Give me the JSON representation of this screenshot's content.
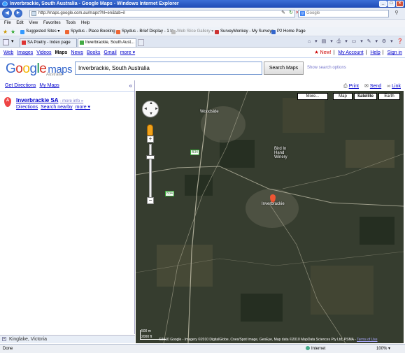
{
  "window": {
    "title": "Inverbrackie, South Australia - Google Maps - Windows Internet Explorer"
  },
  "address": {
    "url": "http://maps.google.com.au/maps?hl=en&tab=il",
    "search_placeholder": "Google"
  },
  "menu": [
    "File",
    "Edit",
    "View",
    "Favorites",
    "Tools",
    "Help"
  ],
  "favorites": [
    "Suggested Sites ▾",
    "Spydus - Place Booking",
    "Spydus - Brief Display - 1 to...",
    "Web Slice Gallery ▾",
    "SurveyMonkey - My Surveys",
    "P2 Home Page"
  ],
  "tabs": [
    {
      "label": "SA Poetry - Index page",
      "active": false
    },
    {
      "label": "Inverbrackie, South Aust...",
      "active": true
    }
  ],
  "google_bar": {
    "links": [
      "Web",
      "Images",
      "Videos"
    ],
    "current": "Maps",
    "links2": [
      "News",
      "Books",
      "Gmail",
      "more ▾"
    ],
    "right": {
      "new": "★ New!",
      "mymaps": "My Account",
      "help": "Help",
      "signin": "Sign in"
    }
  },
  "logo": {
    "google": "Google",
    "maps": "maps",
    "region": "Australia"
  },
  "search": {
    "query": "Inverbrackie, South Australia",
    "button": "Search Maps",
    "options": "Show search options"
  },
  "leftbar": {
    "get_directions": "Get Directions",
    "my_maps": "My Maps",
    "collapse": "«",
    "result": {
      "marker": "A",
      "title": "Inverbrackie SA",
      "more_info": "- more info »",
      "directions": "Directions",
      "search_nearby": "Search nearby",
      "more": "more ▾"
    },
    "recent": "Kinglake, Victoria"
  },
  "map_links": {
    "print": "Print",
    "send": "Send",
    "link": "Link"
  },
  "map": {
    "types": {
      "more": "More...",
      "map": "Map",
      "satellite": "Satellite",
      "earth": "Earth",
      "selected": "satellite"
    },
    "labels": {
      "woodside": "Woodside",
      "winery": "Bird In Hand Winery",
      "place": "Inverbrackie",
      "b34a": "B34",
      "b34b": "B34"
    },
    "scale": {
      "m": "500 m",
      "ft": "2000 ft"
    },
    "copyright": "©2010 Google - Imagery ©2010 DigitalGlobe, Cnes/Spot Image, GeoEye, Map data ©2010 MapData Sciences Pty Ltd, PSMA -",
    "terms": "Terms of Use"
  },
  "status": {
    "left": "Done",
    "zone": "Internet",
    "zoom": "100% ▾"
  }
}
